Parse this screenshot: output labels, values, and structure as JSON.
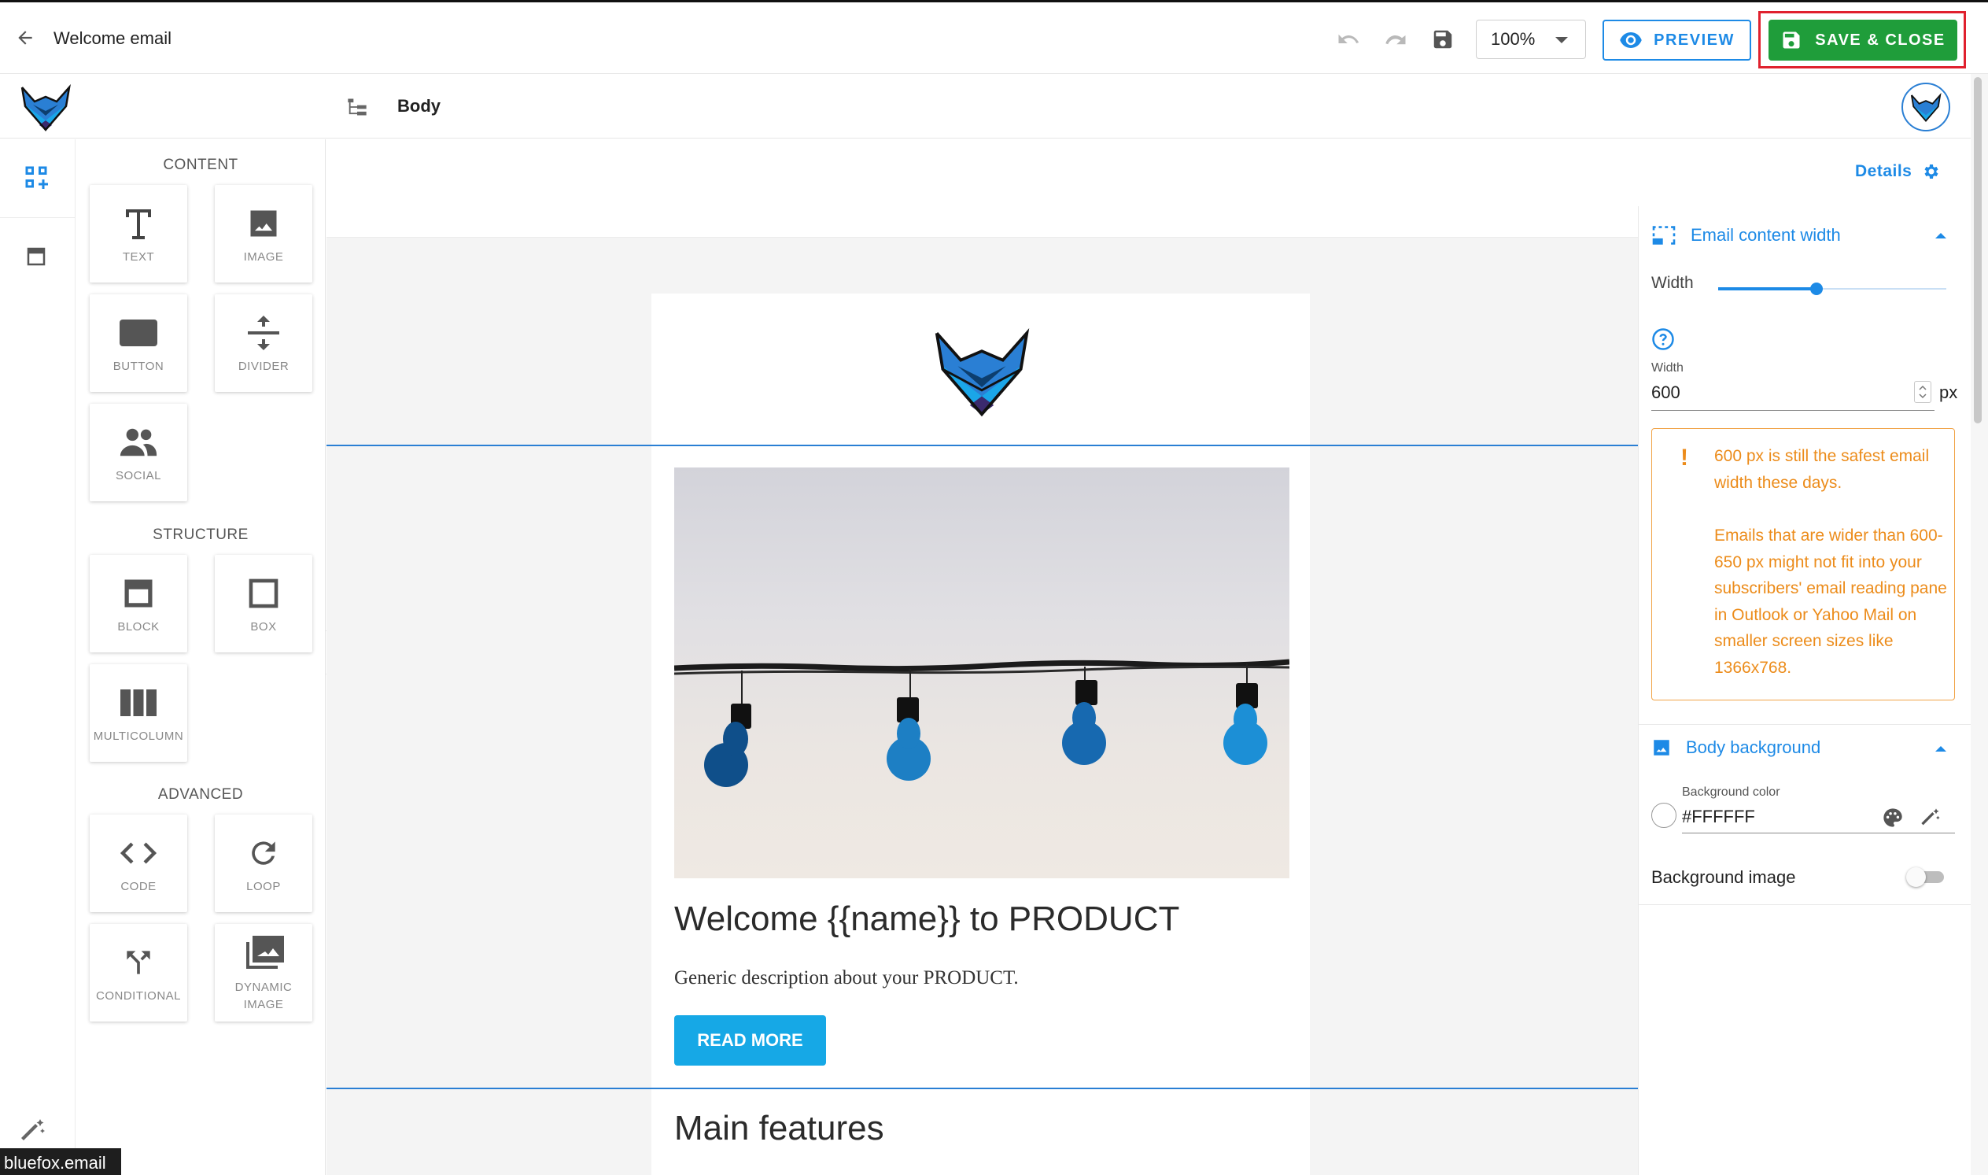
{
  "topbar": {
    "title": "Welcome email",
    "zoom": "100%",
    "preview_label": "PREVIEW",
    "save_label": "SAVE & CLOSE"
  },
  "secondbar": {
    "breadcrumb": "Body"
  },
  "palette": {
    "sections": [
      {
        "title": "CONTENT",
        "items": [
          "TEXT",
          "IMAGE",
          "BUTTON",
          "DIVIDER",
          "SOCIAL"
        ]
      },
      {
        "title": "STRUCTURE",
        "items": [
          "BLOCK",
          "BOX",
          "MULTICOLUMN"
        ]
      },
      {
        "title": "ADVANCED",
        "items": [
          "CODE",
          "LOOP",
          "CONDITIONAL",
          "DYNAMIC IMAGE"
        ]
      }
    ]
  },
  "email": {
    "headline": "Welcome {{name}} to PRODUCT",
    "description": "Generic description about your PRODUCT.",
    "button_label": "READ MORE",
    "section2_heading": "Main features"
  },
  "right_panel": {
    "details_label": "Details",
    "content_width": {
      "heading": "Email content width",
      "slider_label": "Width",
      "field_label": "Width",
      "value": "600",
      "unit": "px",
      "slider_level": 0.43
    },
    "warning": {
      "paragraph1": "600 px is still the safest email width these days.",
      "paragraph2": "Emails that are wider than 600-650 px might not fit into your subscribers' email reading pane in Outlook or Yahoo Mail on smaller screen sizes like 1366x768."
    },
    "body_background": {
      "heading": "Body background",
      "color_label": "Background color",
      "color_value": "#FFFFFF",
      "image_label": "Background image",
      "image_enabled": false
    }
  },
  "tooltip": "bluefox.email",
  "colors": {
    "accent": "#1d8ae6",
    "save_green": "#1f9d3a",
    "highlight_red": "#e0212e",
    "warning_orange": "#ec8c1b",
    "button_blue": "#16a8e6",
    "selection_blue": "#2a7fd4"
  },
  "icons": {
    "back": "arrow-left-icon",
    "undo": "undo-icon",
    "redo": "redo-icon",
    "save": "floppy-disk-icon",
    "preview": "eye-icon",
    "logo": "fox-logo-icon",
    "layers": "layer-tree-icon",
    "settings": "gear-icon"
  }
}
